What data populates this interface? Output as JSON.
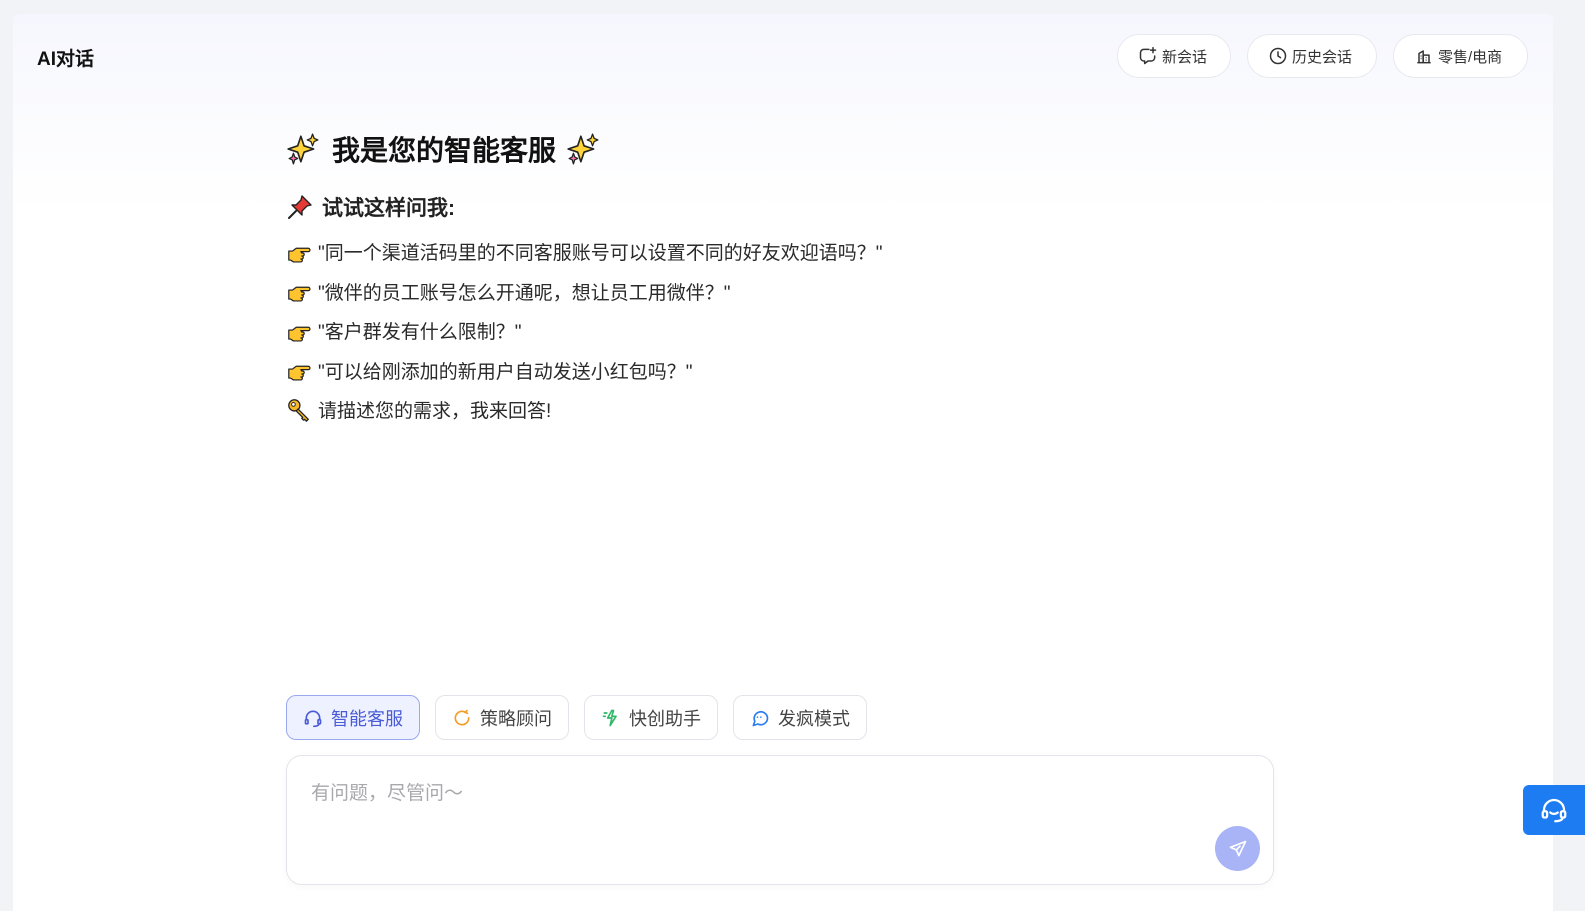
{
  "app": {
    "title": "AI对话"
  },
  "header": {
    "new_chat": "新会话",
    "history": "历史会话",
    "industry": "零售/电商"
  },
  "welcome": {
    "title": "我是您的智能客服",
    "subtitle": "试试这样问我:",
    "questions": [
      "\"同一个渠道活码里的不同客服账号可以设置不同的好友欢迎语吗？\"",
      "\"微伴的员工账号怎么开通呢，想让员工用微伴？\"",
      "\"客户群发有什么限制？\"",
      "\"可以给刚添加的新用户自动发送小红包吗？\""
    ],
    "closing": "请描述您的需求，我来回答!"
  },
  "modes": [
    {
      "label": "智能客服",
      "icon": "headset-icon",
      "active": true
    },
    {
      "label": "策略顾问",
      "icon": "strategy-icon",
      "active": false
    },
    {
      "label": "快创助手",
      "icon": "spark-icon",
      "active": false
    },
    {
      "label": "发疯模式",
      "icon": "chat-bubble-icon",
      "active": false
    }
  ],
  "input": {
    "placeholder": "有问题，尽管问～",
    "value": ""
  },
  "colors": {
    "accent": "#4a5bd8",
    "send": "#a9b4f6",
    "support": "#1e7cf2"
  }
}
